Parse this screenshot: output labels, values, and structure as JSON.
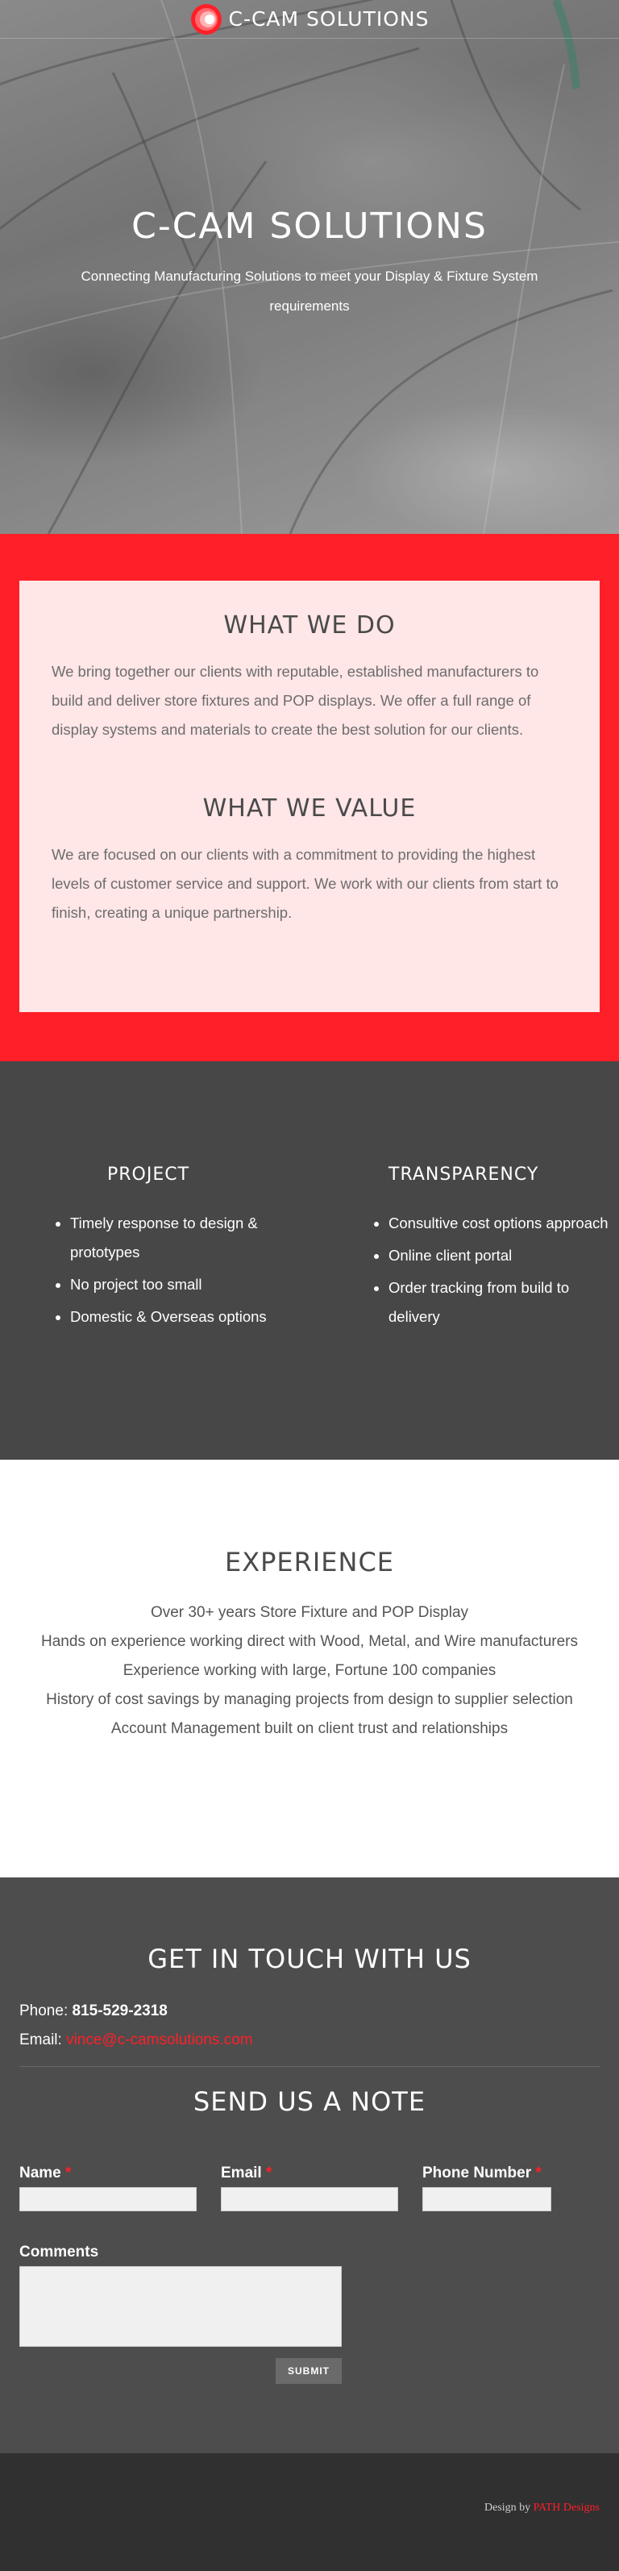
{
  "header": {
    "brand": "C-CAM SOLUTIONS",
    "logo_icon": "c-cam-logo-icon"
  },
  "hero": {
    "title": "C-CAM SOLUTIONS",
    "subtitle": "Connecting Manufacturing Solutions to meet your Display & Fixture System requirements"
  },
  "what_we_do": {
    "heading": "WHAT WE DO",
    "text": "We bring together our clients with reputable, established manufacturers to build and deliver store fixtures and POP displays. We offer a full range of display systems and materials to create the best solution for our clients."
  },
  "what_we_value": {
    "heading": "WHAT WE VALUE",
    "text": "We are focused on our clients with a commitment to providing the highest levels of customer service and support. We work with our clients from start to finish, creating a unique partnership."
  },
  "features": [
    {
      "heading": "PROJECT",
      "items": [
        "Timely response to design & prototypes",
        "No project too small",
        "Domestic & Overseas options"
      ]
    },
    {
      "heading": "TRANSPARENCY",
      "items": [
        "Consultive cost options approach",
        "Online client portal",
        "Order tracking from build to delivery"
      ]
    }
  ],
  "experience": {
    "heading": "EXPERIENCE",
    "lines": [
      "Over 30+ years Store Fixture and POP Display",
      "Hands on experience working direct with Wood, Metal, and Wire manufacturers",
      "Experience working with large, Fortune 100 companies",
      "History of cost savings by managing projects from design to supplier selection",
      "Account Management built on client trust and relationships"
    ]
  },
  "contact": {
    "heading": "GET IN TOUCH WITH US",
    "phone_label": "Phone:",
    "phone": "815-529-2318",
    "email_label": "Email:",
    "email": "vince@c-camsolutions.com"
  },
  "form": {
    "heading": "SEND US A NOTE",
    "name_label": "Name",
    "email_label": "Email",
    "phone_label": "Phone Number",
    "required_mark": "*",
    "comments_label": "Comments",
    "submit_label": "SUBMIT"
  },
  "footer": {
    "design_by": "Design by",
    "designer": "PATH Designs"
  },
  "colors": {
    "accent": "#ff1f28",
    "pink_panel": "#ffe6e7",
    "dark_band": "#474747",
    "contact_band": "#4d4d4d",
    "footer": "#303030"
  }
}
